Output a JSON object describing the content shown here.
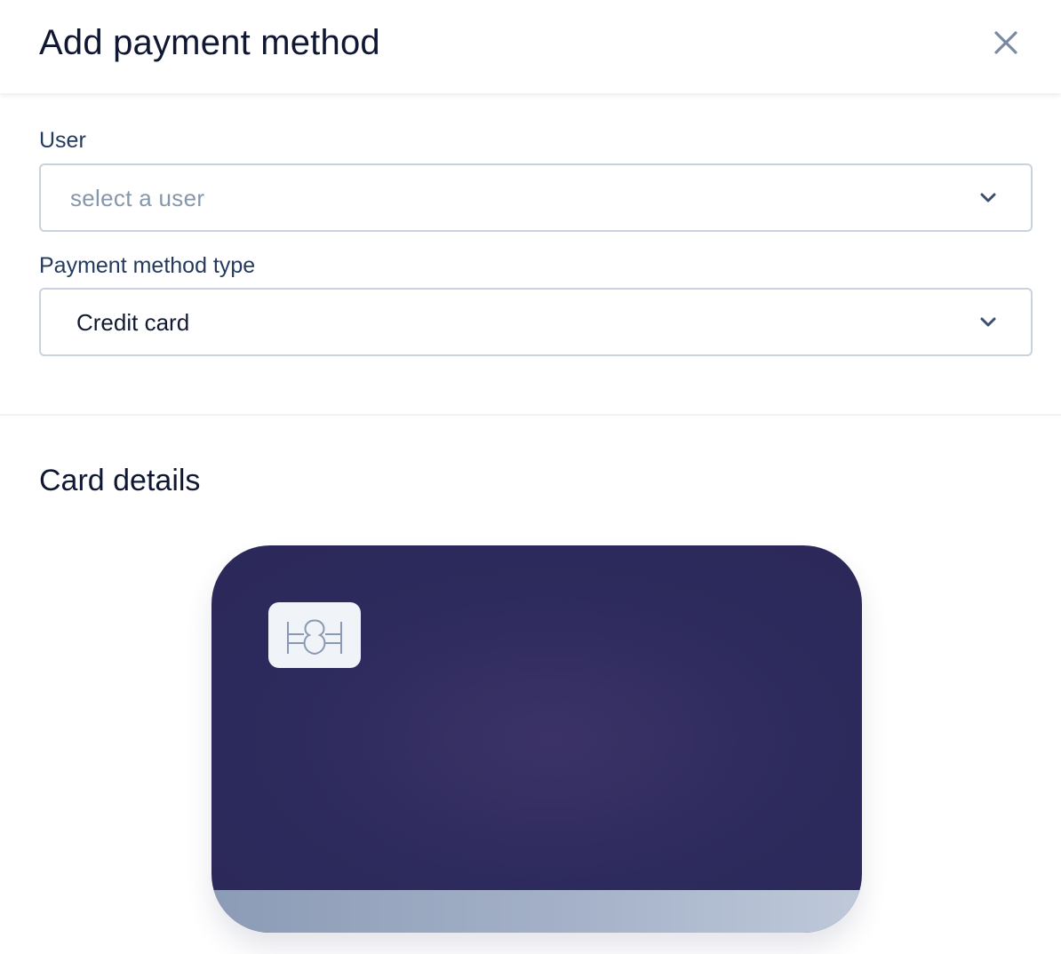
{
  "header": {
    "title": "Add payment method",
    "close_icon": "close-icon"
  },
  "form": {
    "user": {
      "label": "User",
      "placeholder": "select a user",
      "icon": "chevron-down-icon"
    },
    "payment_method_type": {
      "label": "Payment method type",
      "value": "Credit card",
      "icon": "chevron-down-icon"
    }
  },
  "card_details": {
    "title": "Card details",
    "chip_icon": "card-chip-icon"
  },
  "colors": {
    "card_background": "#2d2a5d",
    "card_stripe_start": "#8c9bb6",
    "card_stripe_end": "#bfc9da",
    "field_border": "#c9d2de",
    "placeholder_text": "#8797ab",
    "label_text": "#243a5e",
    "title_text": "#0f1733"
  }
}
